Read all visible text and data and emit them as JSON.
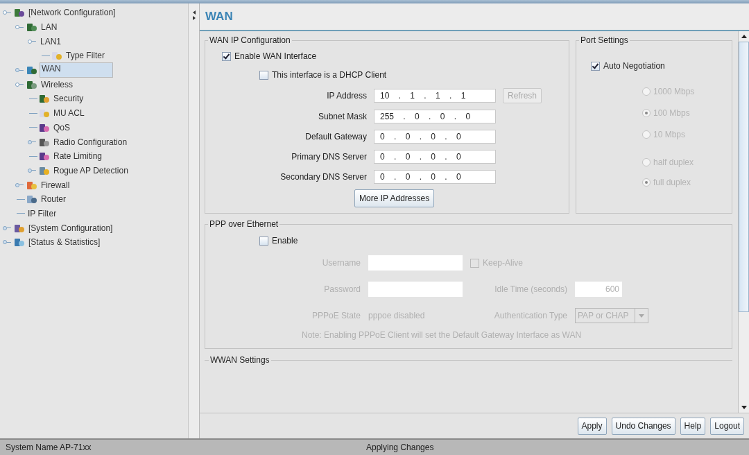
{
  "tree": [
    {
      "label": "[Network Configuration]",
      "kind": "network",
      "expanded": true,
      "selected": false,
      "children": [
        {
          "label": "LAN",
          "kind": "lan",
          "expanded": true,
          "selected": false,
          "children": [
            {
              "label": "LAN1",
              "kind": "plain",
              "expanded": true,
              "selected": false,
              "children": [
                {
                  "label": "Type Filter",
                  "kind": "filter",
                  "selected": false
                }
              ]
            }
          ]
        },
        {
          "label": "WAN",
          "kind": "wan",
          "expanded": false,
          "selected": true
        },
        {
          "label": "Wireless",
          "kind": "wireless",
          "expanded": true,
          "selected": false,
          "children": [
            {
              "label": "Security",
              "kind": "security",
              "selected": false
            },
            {
              "label": "MU ACL",
              "kind": "filter",
              "selected": false
            },
            {
              "label": "QoS",
              "kind": "qos",
              "selected": false
            },
            {
              "label": "Radio Configuration",
              "kind": "radio",
              "expanded": false,
              "selected": false
            },
            {
              "label": "Rate Limiting",
              "kind": "qos",
              "selected": false
            },
            {
              "label": "Rogue AP Detection",
              "kind": "rogue",
              "expanded": false,
              "selected": false
            }
          ]
        },
        {
          "label": "Firewall",
          "kind": "firewall",
          "expanded": false,
          "selected": false
        },
        {
          "label": "Router",
          "kind": "router",
          "selected": false
        },
        {
          "label": "IP Filter",
          "kind": "plain",
          "selected": false
        }
      ]
    },
    {
      "label": "[System Configuration]",
      "kind": "system",
      "expanded": false,
      "selected": false
    },
    {
      "label": "[Status & Statistics]",
      "kind": "status",
      "expanded": false,
      "selected": false
    }
  ],
  "page_title": "WAN",
  "wan_ip": {
    "title": "WAN IP Configuration",
    "enable": {
      "label": "Enable WAN Interface",
      "checked": true
    },
    "dhcp": {
      "label": "This interface is a DHCP Client",
      "checked": false
    },
    "fields": [
      {
        "label": "IP Address",
        "value": "10 . 1 . 1 . 1"
      },
      {
        "label": "Subnet Mask",
        "value": "255 . 0 . 0 . 0"
      },
      {
        "label": "Default Gateway",
        "value": "0 . 0 . 0 . 0"
      },
      {
        "label": "Primary DNS Server",
        "value": "0 . 0 . 0 . 0"
      },
      {
        "label": "Secondary DNS Server",
        "value": "0 . 0 . 0 . 0"
      }
    ],
    "refresh": {
      "label": "Refresh",
      "disabled": true
    },
    "more_button": "More IP Addresses"
  },
  "port": {
    "title": "Port Settings",
    "auto": {
      "label": "Auto Negotiation",
      "checked": true
    },
    "speed": [
      {
        "label": "1000 Mbps",
        "selected": false,
        "disabled": true
      },
      {
        "label": "100 Mbps",
        "selected": true,
        "disabled": true
      },
      {
        "label": "10 Mbps",
        "selected": false,
        "disabled": true
      }
    ],
    "duplex": [
      {
        "label": "half duplex",
        "selected": false,
        "disabled": true
      },
      {
        "label": "full duplex",
        "selected": true,
        "disabled": true
      }
    ]
  },
  "pppoe": {
    "title": "PPP over Ethernet",
    "disabled": true,
    "enable": {
      "label": "Enable",
      "checked": false
    },
    "username": {
      "label": "Username"
    },
    "password": {
      "label": "Password"
    },
    "keep_alive": {
      "label": "Keep-Alive",
      "checked": false
    },
    "idle": {
      "label": "Idle Time (seconds)",
      "value": "600"
    },
    "state": {
      "label": "PPPoE State",
      "value": "pppoe disabled"
    },
    "auth": {
      "label": "Authentication Type",
      "value": "PAP or CHAP"
    },
    "note": "Note: Enabling PPPoE Client will set the Default Gateway Interface as WAN"
  },
  "wwan_title": "WWAN Settings",
  "buttons": [
    "Apply",
    "Undo Changes",
    "Help",
    "Logout"
  ],
  "status_bar": {
    "left": "System Name AP-71xx",
    "center": "Applying Changes"
  }
}
